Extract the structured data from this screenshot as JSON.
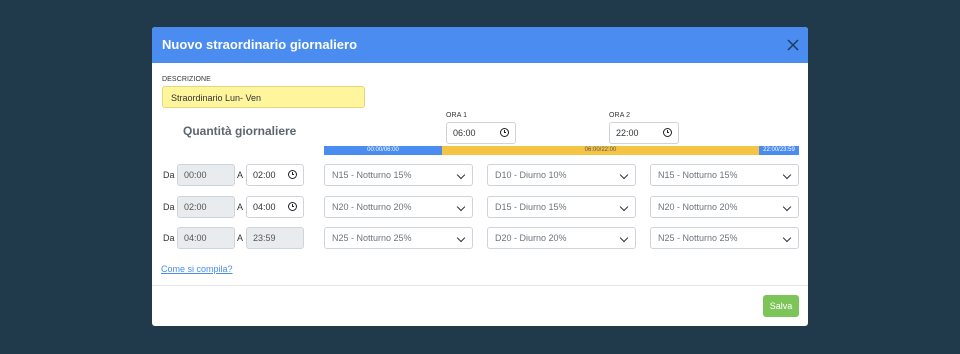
{
  "modal": {
    "title": "Nuovo straordinario giornaliero",
    "close_icon": "close-icon"
  },
  "description": {
    "label": "DESCRIZIONE",
    "value": "Straordinario Lun- Ven"
  },
  "section": {
    "title": "Quantità giornaliere"
  },
  "ora1": {
    "label": "ORA 1",
    "value": "06:00"
  },
  "ora2": {
    "label": "ORA 2",
    "value": "22:00"
  },
  "timeline": {
    "segments": [
      {
        "label": "00:00/06:00",
        "color": "#4a8cf0"
      },
      {
        "label": "06:00/22:00",
        "color": "#f5c445"
      },
      {
        "label": "22:00/23:59",
        "color": "#4a8cf0"
      }
    ]
  },
  "rows": [
    {
      "da_label": "Da",
      "from": "00:00",
      "a_label": "A",
      "to": "02:00",
      "sel1": "N15 - Notturno 15%",
      "sel2": "D10 - Diurno 10%",
      "sel3": "N15 - Notturno 15%"
    },
    {
      "da_label": "Da",
      "from": "02:00",
      "a_label": "A",
      "to": "04:00",
      "sel1": "N20 - Notturno 20%",
      "sel2": "D15 - Diurno 15%",
      "sel3": "N20 - Notturno 20%"
    },
    {
      "da_label": "Da",
      "from": "04:00",
      "a_label": "A",
      "to": "23:59",
      "sel1": "N25 - Notturno 25%",
      "sel2": "D20 - Diurno 20%",
      "sel3": "N25 - Notturno 25%"
    }
  ],
  "help_link": "Come si compila?",
  "save_label": "Salva",
  "colors": {
    "background": "#213a4b",
    "header": "#4a8cf0",
    "description_bg": "#fff59d",
    "save": "#7dc459"
  }
}
